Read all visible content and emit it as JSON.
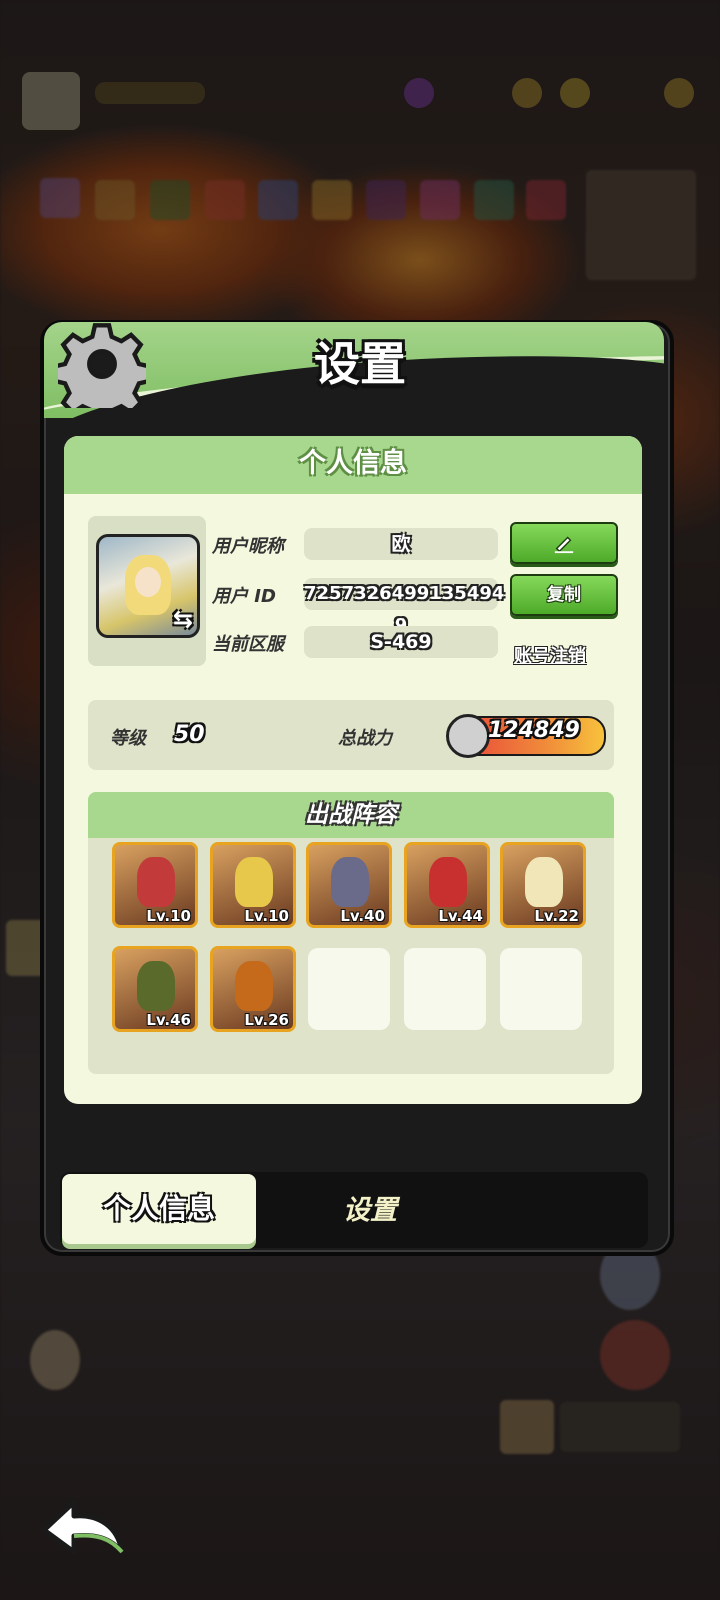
{
  "header": {
    "title": "设置"
  },
  "card": {
    "title": "个人信息"
  },
  "profile": {
    "nickname_label": "用户昵称",
    "nickname_value": "欧",
    "id_label": "用户 ID",
    "id_value": "7257326499135494​9",
    "server_label": "当前区服",
    "server_value": "S-469",
    "copy_label": "复制",
    "logout_label": "账号注销"
  },
  "stats": {
    "level_label": "等级",
    "level_value": "50",
    "power_label": "总战力",
    "power_value": "124849"
  },
  "team": {
    "title": "出战阵容",
    "heroes": [
      {
        "level": "Lv.10",
        "color": "#c23a3a"
      },
      {
        "level": "Lv.10",
        "color": "#e8c84a"
      },
      {
        "level": "Lv.40",
        "color": "#6a6a8a"
      },
      {
        "level": "Lv.44",
        "color": "#c83030"
      },
      {
        "level": "Lv.22",
        "color": "#f0e6b8"
      },
      {
        "level": "Lv.46",
        "color": "#5a6a2a"
      },
      {
        "level": "Lv.26",
        "color": "#c46a1a"
      }
    ]
  },
  "tabs": {
    "personal": "个人信息",
    "settings": "设置"
  }
}
